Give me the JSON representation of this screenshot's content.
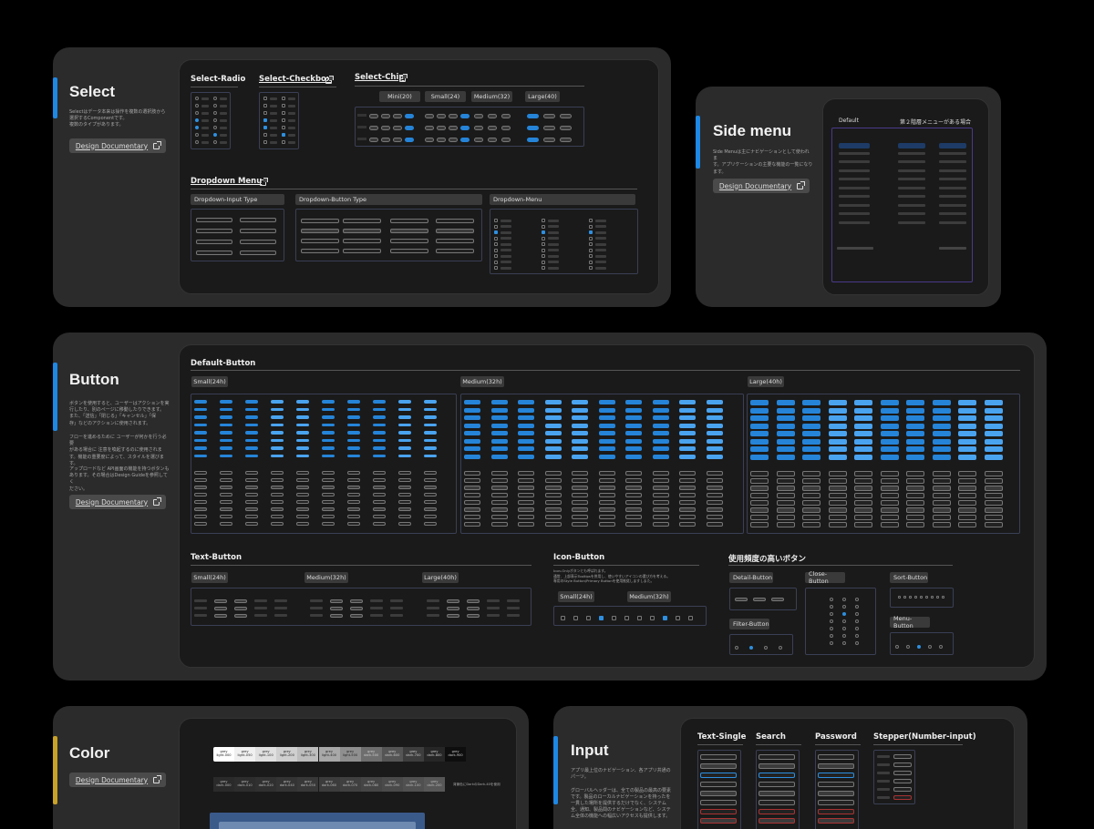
{
  "select": {
    "title": "Select",
    "description": "Selectはデータ本来は操作を複数の選択肢から\n選択するComponentです。\n複数のタイプがあります。",
    "doc_button": "Design Documentary",
    "subsections": {
      "radio": "Select-Radio",
      "checkbox": "Select-Checkbox",
      "chip": "Select-Chip",
      "dropdown": "Dropdown Menu"
    },
    "chip_sizes": [
      "Mini(20)",
      "Small(24)",
      "Medium(32)",
      "Large(40)"
    ],
    "dropdown_types": [
      "Dropdown-Input Type",
      "Dropdown-Button Type",
      "Dropdown-Menu"
    ]
  },
  "side_menu": {
    "title": "Side menu",
    "description": "Side Menuは主にナビゲーションとして使われま\nす。アプリケーションの主要な機能の一覧になり\nます。",
    "doc_button": "Design Documentary",
    "default_label": "Default",
    "nested_label": "第２階層メニューがある場合"
  },
  "button": {
    "title": "Button",
    "description_1": "ボタンを使用すると、ユーザーはアクションを実\n行したり、別のページに移動したりできます。\nまた、「送信」「閉じる」「キャンセル」「保\n存」などのアクションに使用されます。",
    "description_2": "フローを進めるために ユーザーが何かを行う必要\nがある場合に 注意を喚起するのに使用されま\nす。機能の重要度によって、スタイルを選びま\nす。",
    "description_3": "アップロードなど API画面の機能を持つボタンも\nあります。その場合はDesign Guideを参照してく\nださい。",
    "doc_button": "Design Documentary",
    "default_button": "Default-Button",
    "default_sizes": [
      "Small(24h)",
      "Medium(32h)",
      "Large(40h)"
    ],
    "text_button": "Text-Button",
    "text_sizes": [
      "Small(24h)",
      "Medium(32h)",
      "Large(40h)"
    ],
    "icon_button": "Icon-Button",
    "icon_note": "Icon-Onlyボタンとも呼ばれます。\n通常、上部表示Tooltipsを併用し、使いやすいアイコンの選び方を考える。\n専用のStyle Button/Primary Buttonを使用推奨しますしまた。",
    "icon_sizes": [
      "Small(24h)",
      "Medium(32h)"
    ],
    "frequent": "使用頻度の高いボタン",
    "frequent_items": [
      "Detail-Button",
      "Close-Button",
      "Sort-Button",
      "Filter-Button",
      "Menu-Button"
    ]
  },
  "color": {
    "title": "Color",
    "doc_button": "Design Documentary",
    "light_swatches": [
      "grey\nlight-000",
      "grey\nlight-050",
      "grey\nlight-100",
      "grey\nlight-200",
      "grey\nlight-300",
      "grey\nlight-400",
      "grey\nlight-500",
      "grey\ndark-500",
      "grey\ndark-600",
      "grey\ndark-700",
      "grey\ndark-800",
      "grey\ndark-900"
    ],
    "dark_swatches": [
      "grey\ndark-000",
      "grey\ndark-010",
      "grey\ndark-020",
      "grey\ndark-040",
      "grey\ndark-050",
      "grey\ndark-060",
      "grey\ndark-070",
      "grey\ndark-080",
      "grey\ndark-090",
      "grey\ndark-100",
      "grey\ndark-200"
    ],
    "swatch_note": "背景色にDarkのDark-40を使用",
    "light_colors": [
      "#ffffff",
      "#f0f0f0",
      "#e0e0e0",
      "#cfcfcf",
      "#bdbdbd",
      "#a8a8a8",
      "#8f8f8f",
      "#6e6e6e",
      "#555555",
      "#3d3d3d",
      "#262626",
      "#0e0e0e"
    ],
    "dark_colors": [
      "#2a2a2a",
      "#2d2d2d",
      "#303030",
      "#343434",
      "#383838",
      "#3c3c3c",
      "#404040",
      "#454545",
      "#4a4a4a",
      "#505050",
      "#575757"
    ]
  },
  "input": {
    "title": "Input",
    "description": "アプリ最上位のナビゲーション、各アプリ共通の\nパーツ。\n\nグローバルヘッダーは、全ての製品の最高の要素\nです。製品のローカルナビゲーションを持ったを\n一貫した場所を提供するだけでなく、システム\n全、通知、製品間のナビゲーションなど、システ\nム全体の機能への幅広いアクセスも提供します。",
    "types": [
      "Text-Single",
      "Search",
      "Password",
      "Stepper(Number-input)"
    ]
  },
  "colors": {
    "accent_blue": "#1e88e5",
    "accent_gold": "#c9a227",
    "button_blue": "#2584d8"
  }
}
